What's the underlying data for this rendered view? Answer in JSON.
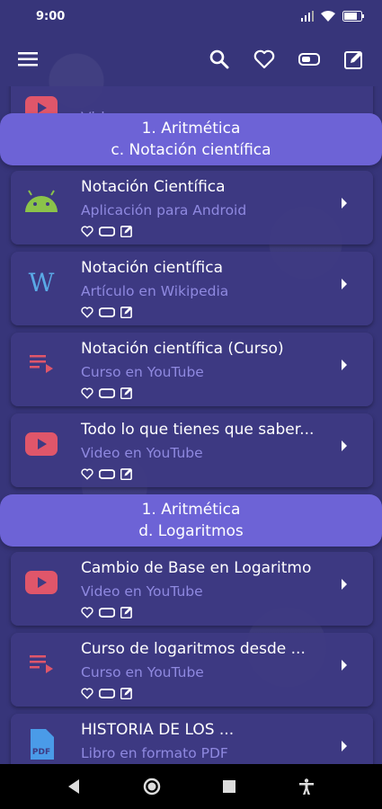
{
  "status_bar": {
    "time": "9:00"
  },
  "app_bar": {
    "icons": [
      "menu-icon",
      "search-icon",
      "heart-icon",
      "battery-toggle-icon",
      "edit-icon"
    ]
  },
  "partial_top_card": {
    "title": "Video en",
    "note": "partially visible above header"
  },
  "sections": [
    {
      "line1": "1. Aritmética",
      "line2": "c. Notación científica"
    },
    {
      "line1": "1. Aritmética",
      "line2": "d. Logaritmos"
    }
  ],
  "items": [
    {
      "title": "Notación Científica",
      "subtitle": "Aplicación para Android",
      "icon": "android-icon"
    },
    {
      "title": "Notación científica",
      "subtitle": "Artículo en Wikipedia",
      "icon": "wikipedia-icon"
    },
    {
      "title": "Notación científica (Curso)",
      "subtitle": "Curso en YouTube",
      "icon": "playlist-icon"
    },
    {
      "title": "Todo lo que tienes que saber...",
      "subtitle": "Video en YouTube",
      "icon": "youtube-icon"
    },
    {
      "title": "Cambio de Base en Logaritmo",
      "subtitle": "Video en YouTube",
      "icon": "youtube-icon"
    },
    {
      "title": "Curso de logaritmos desde ...",
      "subtitle": "Curso en YouTube",
      "icon": "playlist-icon"
    },
    {
      "title": "HISTORIA DE LOS ...",
      "subtitle": "Libro en formato PDF",
      "icon": "pdf-icon"
    }
  ],
  "colors": {
    "background": "#37357a",
    "header": "#6d63d6",
    "card": "#3e3a82",
    "subtitle": "#8f89e0",
    "youtube_red": "#e0566a",
    "android_green": "#8bc34a",
    "wiki_blue": "#5aa9e6",
    "pdf_blue": "#4a9be8"
  }
}
